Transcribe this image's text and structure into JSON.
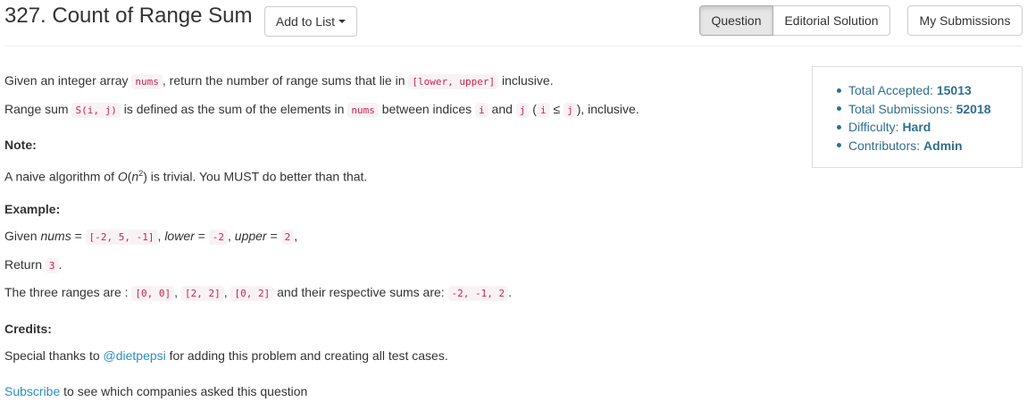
{
  "header": {
    "title": "327. Count of Range Sum",
    "add_to_list": "Add to List",
    "tabs": [
      "Question",
      "Editorial Solution"
    ],
    "my_submissions": "My Submissions"
  },
  "description": {
    "p1": {
      "t1": "Given an integer array ",
      "c1": "nums",
      "t2": ", return the number of range sums that lie in ",
      "c2": "[lower, upper]",
      "t3": " inclusive."
    },
    "p2": {
      "t1": "Range sum ",
      "c1": "S(i, j)",
      "t2": " is defined as the sum of the elements in ",
      "c2": "nums",
      "t3": " between indices ",
      "c3": "i",
      "t4": " and ",
      "c4": "j",
      "t5": " (",
      "c5": "i",
      "t6": " ≤ ",
      "c6": "j",
      "t7": "), inclusive."
    },
    "note_label": "Note:",
    "note": {
      "t1": "A naive algorithm of ",
      "o": "O",
      "t2": "(",
      "n": "n",
      "sup": "2",
      "t3": ") is trivial. You MUST do better than that."
    },
    "example_label": "Example:",
    "example": {
      "given": {
        "t1": "Given ",
        "nums_em": "nums",
        "eq1": " = ",
        "c1": "[-2, 5, -1]",
        "t2": ", ",
        "lower_em": "lower",
        "eq2": " = ",
        "c2": "-2",
        "t3": ", ",
        "upper_em": "upper",
        "eq3": " = ",
        "c3": "2",
        "t4": ","
      },
      "return": {
        "t1": "Return ",
        "c1": "3",
        "t2": "."
      },
      "ranges": {
        "t1": "The three ranges are : ",
        "c1": "[0, 0]",
        "s1": ", ",
        "c2": "[2, 2]",
        "s2": ", ",
        "c3": "[0, 2]",
        "t2": " and their respective sums are: ",
        "c4": "-2, -1, 2",
        "t3": "."
      }
    },
    "credits_label": "Credits:",
    "credits": {
      "t1": "Special thanks to ",
      "link": "@dietpepsi",
      "t2": " for adding this problem and creating all test cases."
    },
    "subscribe": {
      "link": "Subscribe",
      "t1": " to see which companies asked this question"
    }
  },
  "stats": {
    "accepted_label": "Total Accepted: ",
    "accepted": "15013",
    "submissions_label": "Total Submissions: ",
    "submissions": "52018",
    "difficulty_label": "Difficulty: ",
    "difficulty": "Hard",
    "contributors_label": "Contributors: ",
    "contributors": "Admin"
  },
  "colors": {
    "link": "#2a8ec7",
    "code_fg": "#c7254e",
    "code_bg": "#f9f2f4",
    "stats": "#2f6f8f"
  }
}
